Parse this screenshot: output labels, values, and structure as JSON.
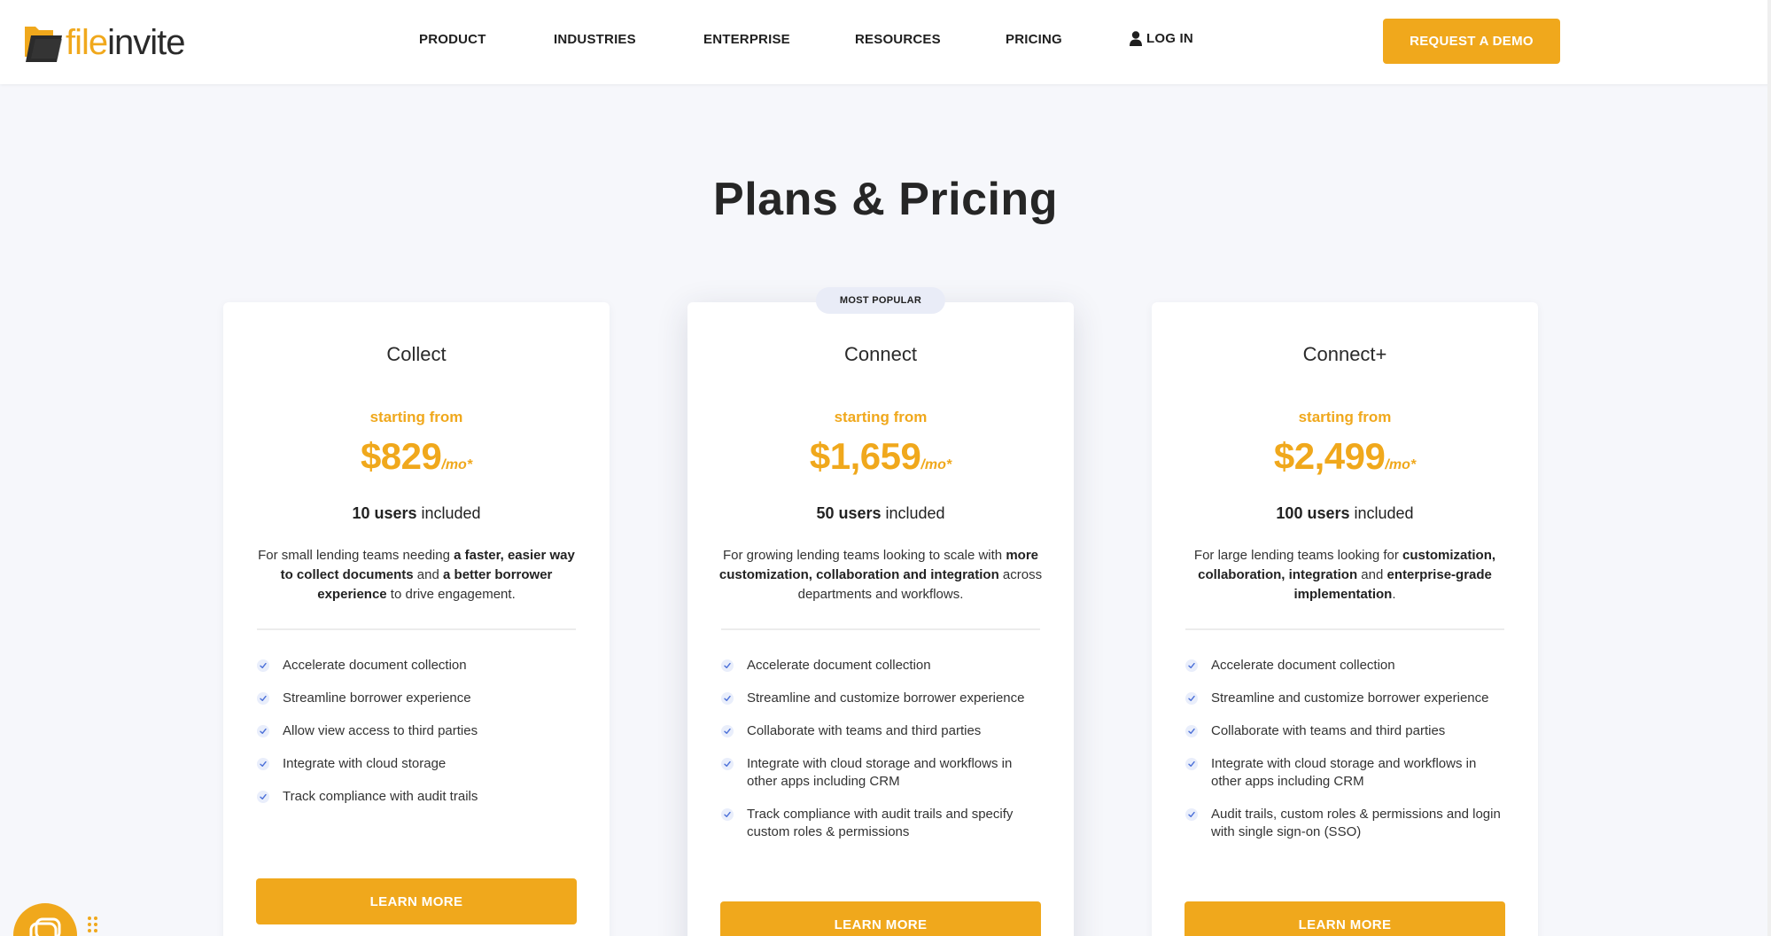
{
  "header": {
    "logo": {
      "file": "file",
      "invite": "invite"
    },
    "nav": {
      "product": "PRODUCT",
      "industries": "INDUSTRIES",
      "enterprise": "ENTERPRISE",
      "resources": "RESOURCES",
      "pricing": "PRICING",
      "login": "LOG IN"
    },
    "demo_button": "REQUEST A DEMO"
  },
  "page_title": "Plans & Pricing",
  "plans": [
    {
      "name": "Collect",
      "starting": "starting from",
      "price": "$829",
      "per": "/mo*",
      "users_count": "10 users",
      "users_suffix": " included",
      "desc": [
        {
          "t": "For small lending teams needing ",
          "b": false
        },
        {
          "t": "a faster, easier way to collect documents",
          "b": true
        },
        {
          "t": " and ",
          "b": false
        },
        {
          "t": "a better borrower experience",
          "b": true
        },
        {
          "t": " to drive engagement.",
          "b": false
        }
      ],
      "features": [
        "Accelerate document collection",
        "Streamline borrower experience",
        "Allow view access to third parties",
        "Integrate with cloud storage",
        "Track compliance with audit trails"
      ],
      "button": "LEARN MORE"
    },
    {
      "name": "Connect",
      "badge": "MOST POPULAR",
      "starting": "starting from",
      "price": "$1,659",
      "per": "/mo*",
      "users_count": "50 users",
      "users_suffix": " included",
      "desc": [
        {
          "t": "For growing lending teams looking to scale with ",
          "b": false
        },
        {
          "t": "more customization, collaboration and integration",
          "b": true
        },
        {
          "t": " across departments and workflows.",
          "b": false
        }
      ],
      "features": [
        "Accelerate document collection",
        "Streamline and customize borrower experience",
        "Collaborate with teams and third parties",
        "Integrate with cloud storage and workflows in other apps including CRM",
        "Track compliance with audit trails and specify custom roles & permissions"
      ],
      "button": "LEARN MORE"
    },
    {
      "name": "Connect+",
      "starting": "starting from",
      "price": "$2,499",
      "per": "/mo*",
      "users_count": "100 users",
      "users_suffix": " included",
      "desc": [
        {
          "t": "For large lending teams looking for ",
          "b": false
        },
        {
          "t": "customization, collaboration, integration",
          "b": true
        },
        {
          "t": " and ",
          "b": false
        },
        {
          "t": "enterprise-grade implementation",
          "b": true
        },
        {
          "t": ".",
          "b": false
        }
      ],
      "features": [
        "Accelerate document collection",
        "Streamline and customize borrower experience",
        "Collaborate with teams and third parties",
        "Integrate with cloud storage and workflows in other apps including CRM",
        "Audit trails, custom roles & permissions and login with single sign-on (SSO)"
      ],
      "button": "LEARN MORE"
    }
  ],
  "colors": {
    "accent": "#f0a81c",
    "text": "#222222",
    "background": "#f6f7fb",
    "badge": "#e9ecf7"
  },
  "icons": [
    "logo-folder-icon",
    "user-icon",
    "check-icon",
    "chat-icon",
    "grip-dots-icon"
  ]
}
